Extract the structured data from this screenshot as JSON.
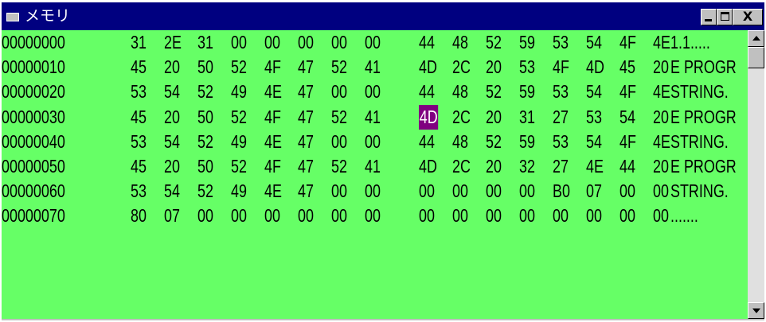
{
  "window": {
    "title": "メモリ",
    "minimize_icon": "minimize-icon",
    "maximize_icon": "maximize-icon",
    "close_label": "X"
  },
  "memory": {
    "rows": [
      {
        "address": "00000000",
        "bytes": [
          "31",
          "2E",
          "31",
          "00",
          "00",
          "00",
          "00",
          "00",
          "44",
          "48",
          "52",
          "59",
          "53",
          "54",
          "4F",
          "4E"
        ],
        "ascii": "1.1....."
      },
      {
        "address": "00000010",
        "bytes": [
          "45",
          "20",
          "50",
          "52",
          "4F",
          "47",
          "52",
          "41",
          "4D",
          "2C",
          "20",
          "53",
          "4F",
          "4D",
          "45",
          "20"
        ],
        "ascii": "E PROGR"
      },
      {
        "address": "00000020",
        "bytes": [
          "53",
          "54",
          "52",
          "49",
          "4E",
          "47",
          "00",
          "00",
          "44",
          "48",
          "52",
          "59",
          "53",
          "54",
          "4F",
          "4E"
        ],
        "ascii": "STRING."
      },
      {
        "address": "00000030",
        "bytes": [
          "45",
          "20",
          "50",
          "52",
          "4F",
          "47",
          "52",
          "41",
          "4D",
          "2C",
          "20",
          "31",
          "27",
          "53",
          "54",
          "20"
        ],
        "ascii": "E PROGR"
      },
      {
        "address": "00000040",
        "bytes": [
          "53",
          "54",
          "52",
          "49",
          "4E",
          "47",
          "00",
          "00",
          "44",
          "48",
          "52",
          "59",
          "53",
          "54",
          "4F",
          "4E"
        ],
        "ascii": "STRING."
      },
      {
        "address": "00000050",
        "bytes": [
          "45",
          "20",
          "50",
          "52",
          "4F",
          "47",
          "52",
          "41",
          "4D",
          "2C",
          "20",
          "32",
          "27",
          "4E",
          "44",
          "20"
        ],
        "ascii": "E PROGR"
      },
      {
        "address": "00000060",
        "bytes": [
          "53",
          "54",
          "52",
          "49",
          "4E",
          "47",
          "00",
          "00",
          "00",
          "00",
          "00",
          "00",
          "B0",
          "07",
          "00",
          "00"
        ],
        "ascii": "STRING."
      },
      {
        "address": "00000070",
        "bytes": [
          "80",
          "07",
          "00",
          "00",
          "00",
          "00",
          "00",
          "00",
          "00",
          "00",
          "00",
          "00",
          "00",
          "00",
          "00",
          "00"
        ],
        "ascii": "......."
      }
    ],
    "selected": {
      "row": 3,
      "byte": 8
    }
  },
  "colors": {
    "titlebar": "#000080",
    "background": "#66ff66",
    "selection": "#800080"
  }
}
